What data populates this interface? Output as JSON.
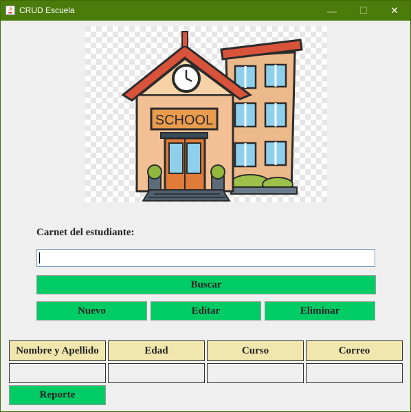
{
  "window": {
    "title": "CRUD Escuela",
    "controls": {
      "minimize": "—",
      "maximize": "☐",
      "close": "✕"
    },
    "colors": {
      "titlebar": "#4b7b0b",
      "button_green": "#00cc66",
      "header_bg": "#f1e6ad"
    }
  },
  "illustration": {
    "icon": "school-building-illustration",
    "sign_text": "SCHOOL"
  },
  "form": {
    "carnet_label": "Carnet del estudiante:",
    "carnet_value": "",
    "buttons": {
      "buscar": "Buscar",
      "nuevo": "Nuevo",
      "editar": "Editar",
      "eliminar": "Eliminar"
    }
  },
  "table": {
    "headers": [
      "Nombre y Apellido",
      "Edad",
      "Curso",
      "Correo"
    ],
    "row": [
      "",
      "",
      "",
      ""
    ]
  },
  "report_button": "Reporte"
}
